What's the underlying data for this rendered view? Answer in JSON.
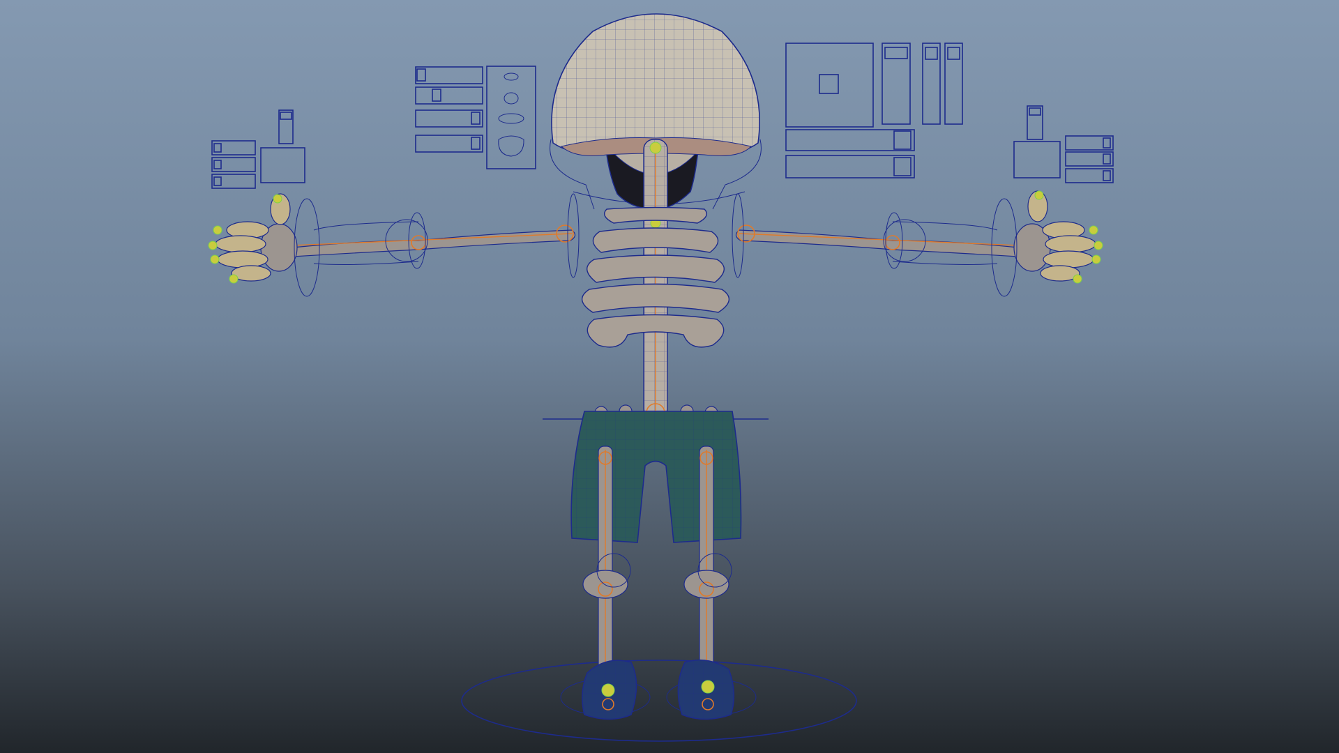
{
  "viewport": {
    "background_top": "#8499b1",
    "background_bottom": "#21262b",
    "wireframe_color": "#1d2b8c",
    "joint_color": "#e07a2a",
    "fk_control_color": "#7cd24a"
  },
  "character": {
    "head_color": "#c8c1b3",
    "bone_color": "#9c9590",
    "shorts_color": "#2c5a5a",
    "shoes_color": "#223a72"
  },
  "icons": {
    "head_control": "dome-wire-icon",
    "ground_control": "ellipse-ring-icon",
    "face_panel": "face-ui-icon",
    "slider_panel": "slider-icon"
  }
}
